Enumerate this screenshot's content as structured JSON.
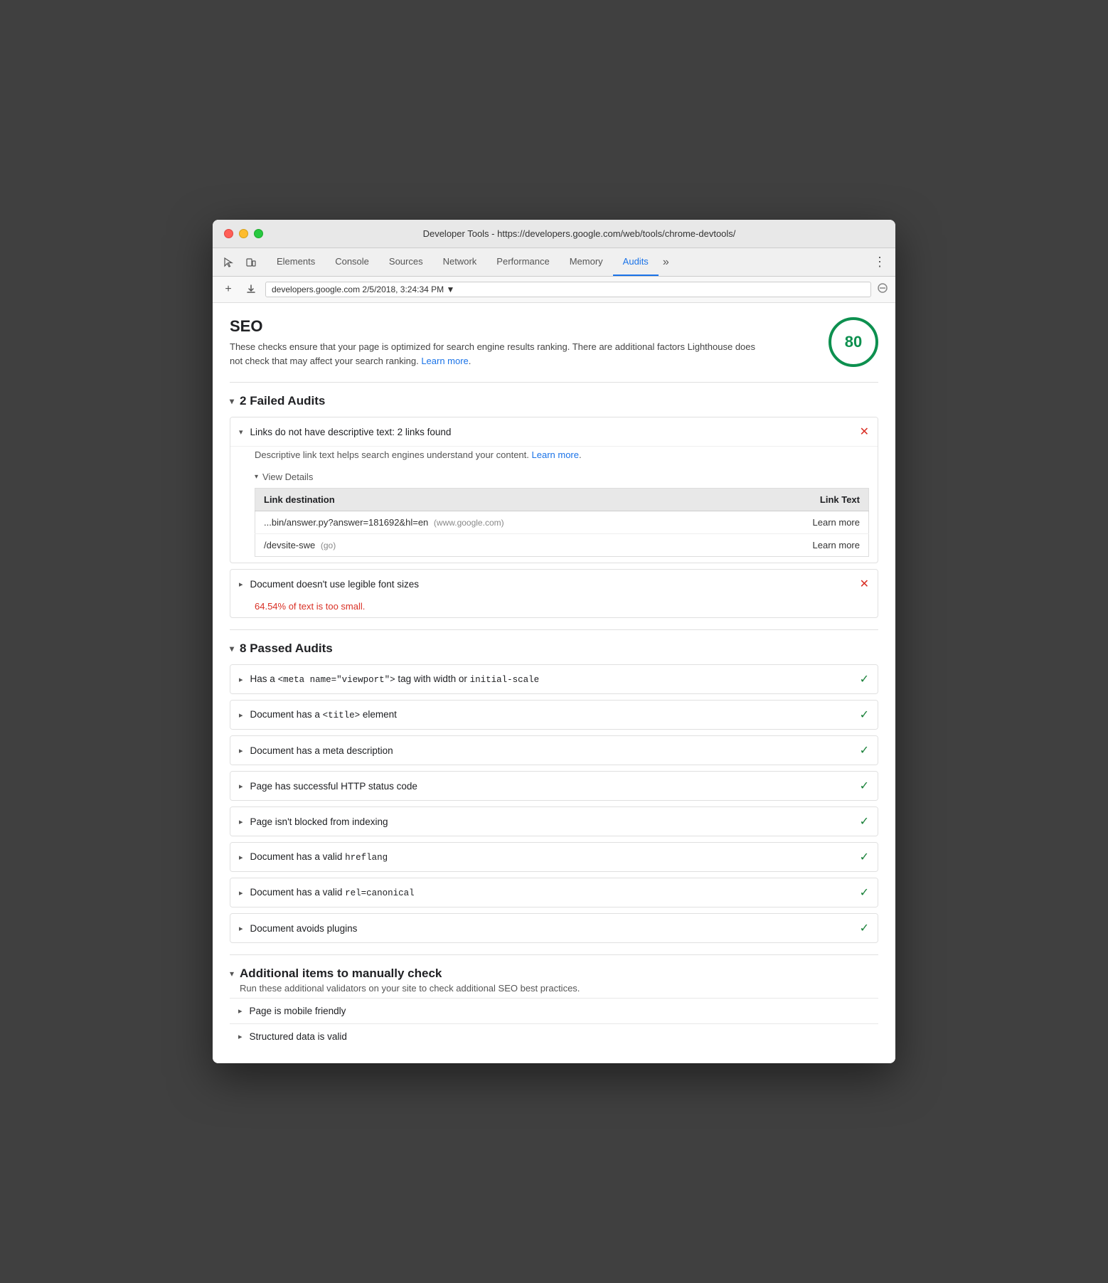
{
  "window": {
    "title": "Developer Tools - https://developers.google.com/web/tools/chrome-devtools/"
  },
  "tabs": [
    {
      "id": "elements",
      "label": "Elements",
      "active": false
    },
    {
      "id": "console",
      "label": "Console",
      "active": false
    },
    {
      "id": "sources",
      "label": "Sources",
      "active": false
    },
    {
      "id": "network",
      "label": "Network",
      "active": false
    },
    {
      "id": "performance",
      "label": "Performance",
      "active": false
    },
    {
      "id": "memory",
      "label": "Memory",
      "active": false
    },
    {
      "id": "audits",
      "label": "Audits",
      "active": true
    }
  ],
  "address_bar": {
    "value": "developers.google.com 2/5/2018, 3:24:34 PM ▼"
  },
  "seo": {
    "title": "SEO",
    "description": "These checks ensure that your page is optimized for search engine results ranking. There are additional factors Lighthouse does not check that may affect your search ranking.",
    "learn_more_text": "Learn more",
    "learn_more_url": "#",
    "score": "80"
  },
  "failed_audits": {
    "heading": "2 Failed Audits",
    "items": [
      {
        "id": "links-text",
        "title": "Links do not have descriptive text: 2 links found",
        "description": "Descriptive link text helps search engines understand your content.",
        "learn_more_text": "Learn more",
        "expanded": true,
        "view_details_label": "View Details",
        "table": {
          "col1": "Link destination",
          "col2": "Link Text",
          "rows": [
            {
              "dest": "...bin/answer.py?answer=181692&hl=en",
              "dest_secondary": "(www.google.com)",
              "link_text": "Learn more"
            },
            {
              "dest": "/devsite-swe",
              "dest_secondary": "(go)",
              "link_text": "Learn more"
            }
          ]
        }
      },
      {
        "id": "font-size",
        "title": "Document doesn't use legible font sizes",
        "fail_text": "64.54% of text is too small.",
        "expanded": false
      }
    ]
  },
  "passed_audits": {
    "heading": "8 Passed Audits",
    "items": [
      {
        "id": "viewport",
        "title_html": "Has a <meta name=\"viewport\"> tag with width or initial-scale"
      },
      {
        "id": "title",
        "title_html": "Document has a <title> element"
      },
      {
        "id": "meta-desc",
        "title_html": "Document has a meta description"
      },
      {
        "id": "http-status",
        "title_html": "Page has successful HTTP status code"
      },
      {
        "id": "indexing",
        "title_html": "Page isn't blocked from indexing"
      },
      {
        "id": "hreflang",
        "title_html": "Document has a valid hreflang"
      },
      {
        "id": "canonical",
        "title_html": "Document has a valid rel=canonical"
      },
      {
        "id": "plugins",
        "title_html": "Document avoids plugins"
      }
    ]
  },
  "additional": {
    "heading": "Additional items to manually check",
    "description": "Run these additional validators on your site to check additional SEO best practices.",
    "items": [
      {
        "id": "mobile-friendly",
        "title": "Page is mobile friendly"
      },
      {
        "id": "structured-data",
        "title": "Structured data is valid"
      }
    ]
  },
  "icons": {
    "cursor": "⬚",
    "mobile": "☐",
    "chevron_down": "▾",
    "chevron_right": "▸",
    "more": "»",
    "menu": "⋮",
    "plus": "+",
    "download": "⬇",
    "no_symbol": "⊘",
    "cross": "✕",
    "check": "✓"
  }
}
